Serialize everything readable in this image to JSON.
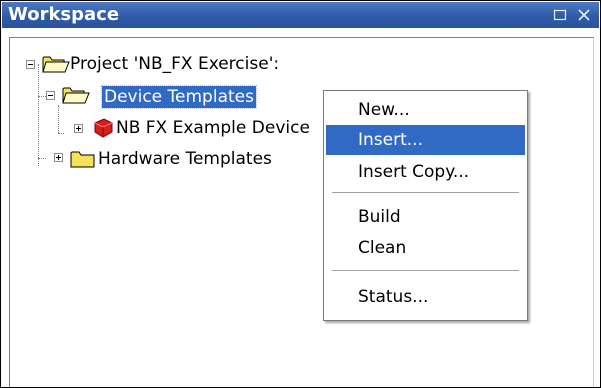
{
  "window": {
    "title": "Workspace",
    "restore_icon": "restore-icon",
    "close_icon": "close-icon"
  },
  "tree": {
    "root": {
      "label": "Project 'NB_FX Exercise':",
      "expanded": true,
      "icon": "open-folder-icon"
    },
    "device_templates": {
      "label": "Device Templates",
      "expanded": true,
      "selected": true,
      "icon": "open-folder-icon"
    },
    "device_example": {
      "label": "NB FX Example Device",
      "expanded": false,
      "icon": "device-icon"
    },
    "hardware_templates": {
      "label": "Hardware Templates",
      "expanded": false,
      "icon": "folder-icon"
    }
  },
  "context_menu": {
    "items": [
      {
        "label": "New..."
      },
      {
        "label": "Insert...",
        "highlighted": true
      },
      {
        "label": "Insert Copy..."
      },
      {
        "label": "Build"
      },
      {
        "label": "Clean"
      },
      {
        "label": "Status..."
      }
    ]
  },
  "colors": {
    "title_bar": "#2e5ba8",
    "selection": "#316ac5",
    "folder": "#f5e15a",
    "device": "#d81e1e"
  }
}
